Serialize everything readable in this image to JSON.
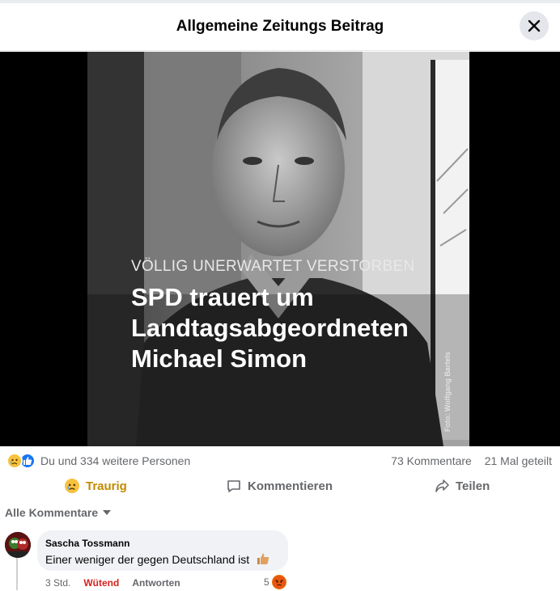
{
  "dialog": {
    "title": "Allgemeine Zeitungs Beitrag"
  },
  "post_image": {
    "kicker": "VÖLLIG UNERWARTET VERSTORBEN",
    "headline_lines": [
      "SPD trauert um",
      "Landtagsabgeordneten",
      "Michael Simon"
    ],
    "credit": "Foto: Wolfgang Bartels"
  },
  "stats": {
    "reactions_text": "Du und 334 weitere Personen",
    "comments_count": "73 Kommentare",
    "shares_count": "21 Mal geteilt",
    "reaction_icons": [
      "sad-emoji-icon",
      "like-thumb-icon"
    ]
  },
  "actions": {
    "react_label": "Traurig",
    "comment_label": "Kommentieren",
    "share_label": "Teilen"
  },
  "comments_sort": {
    "label": "Alle Kommentare"
  },
  "comments": [
    {
      "author": "Sascha Tossmann",
      "text": "Einer weniger der gegen Deutschland ist",
      "time": "3 Std.",
      "my_reaction": "Wütend",
      "reply_label": "Antworten",
      "reaction_count": "5"
    }
  ],
  "colors": {
    "accent_blue": "#1877f2",
    "sad_yellow": "#c28a00",
    "angry_red": "#d6231f",
    "muted_text": "#65676b",
    "bubble_bg": "#f0f2f5"
  }
}
